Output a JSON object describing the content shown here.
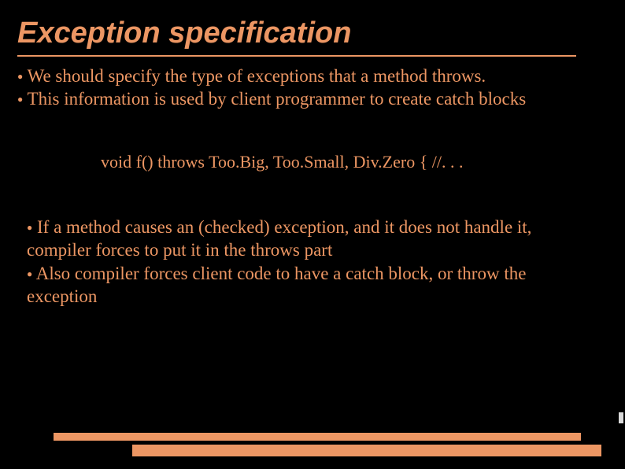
{
  "title": "Exception specification",
  "block1": {
    "item1": "We should specify the type of exceptions that a method throws.",
    "item2": "This information is used by client programmer to create catch blocks"
  },
  "code_line": "void f() throws Too.Big, Too.Small, Div.Zero { //. . .",
  "block2": {
    "item1": "If a method causes an (checked) exception, and it does not handle it, compiler forces to put it in the throws part",
    "item2": "Also compiler forces client code to have a catch block, or throw the exception"
  }
}
